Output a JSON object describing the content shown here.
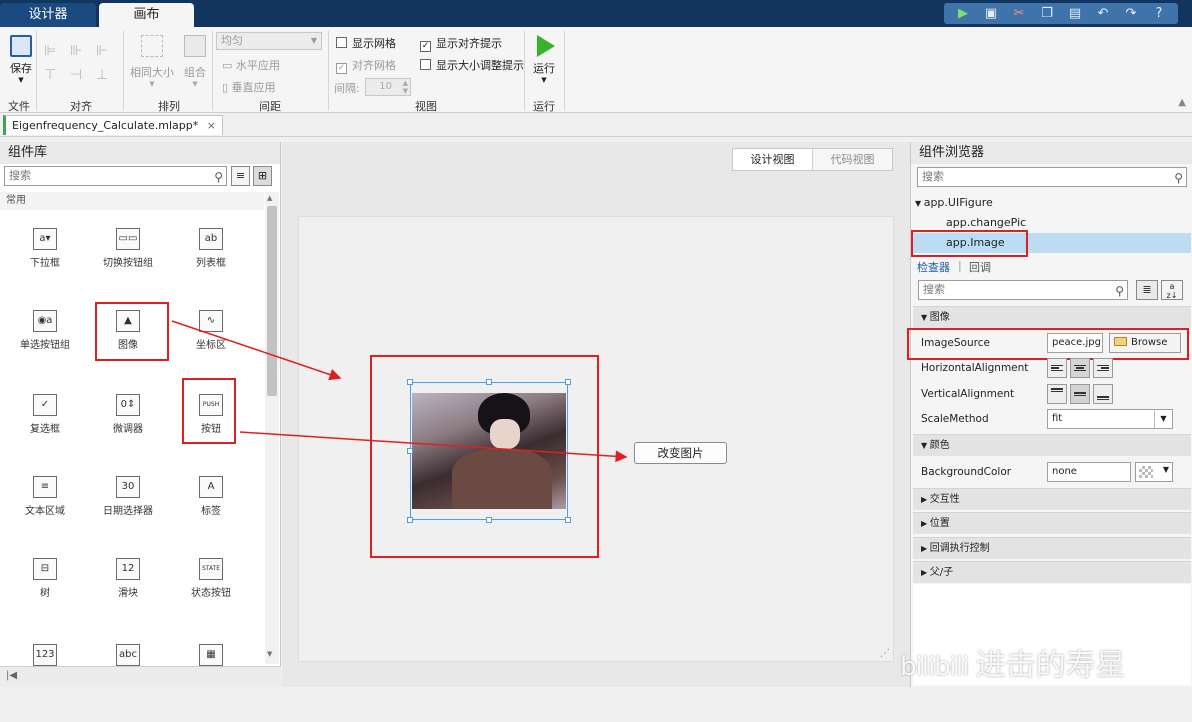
{
  "tabs": {
    "designer": "设计器",
    "canvas": "画布"
  },
  "quick_access": [
    "run-icon",
    "save-icon",
    "cut-icon",
    "copy-icon",
    "paste-icon",
    "undo-icon",
    "redo-icon",
    "help-icon"
  ],
  "ribbon": {
    "save": "保存",
    "same_size": "相同大小",
    "group": "组合",
    "spacing_select": "均匀",
    "apply_horizontal": "水平应用",
    "apply_vertical": "垂直应用",
    "show_grid": "显示网格",
    "snap_grid": "对齐网格",
    "interval": "间隔:",
    "interval_value": "10",
    "show_align_hints": "显示对齐提示",
    "show_resize_hints": "显示大小调整提示",
    "run": "运行",
    "groups": {
      "file": "文件",
      "align": "对齐",
      "arrange": "排列",
      "spacing": "间距",
      "view": "视图",
      "run": "运行"
    }
  },
  "document_tab": "Eigenfrequency_Calculate.mlapp*",
  "library": {
    "title": "组件库",
    "search_placeholder": "搜索",
    "category": "常用",
    "components": [
      {
        "label": "下拉框",
        "glyph": "a▾"
      },
      {
        "label": "切换按钮组",
        "glyph": "▭▭"
      },
      {
        "label": "列表框",
        "glyph": "ab"
      },
      {
        "label": "单选按钮组",
        "glyph": "◉a"
      },
      {
        "label": "图像",
        "glyph": "▲"
      },
      {
        "label": "坐标区",
        "glyph": "∿"
      },
      {
        "label": "复选框",
        "glyph": "✓"
      },
      {
        "label": "微调器",
        "glyph": "0⇕"
      },
      {
        "label": "按钮",
        "glyph": "PUSH"
      },
      {
        "label": "文本区域",
        "glyph": "≡"
      },
      {
        "label": "日期选择器",
        "glyph": "30"
      },
      {
        "label": "标签",
        "glyph": "A"
      },
      {
        "label": "树",
        "glyph": "⊟"
      },
      {
        "label": "滑块",
        "glyph": "12"
      },
      {
        "label": "状态按钮",
        "glyph": "STATE"
      },
      {
        "label": "",
        "glyph": "123"
      },
      {
        "label": "",
        "glyph": "abc"
      },
      {
        "label": "",
        "glyph": "▦"
      }
    ]
  },
  "canvas": {
    "design_view": "设计视图",
    "code_view": "代码视图",
    "button_label": "改变图片"
  },
  "browser": {
    "title": "组件浏览器",
    "search_placeholder": "搜索",
    "tree": {
      "root": "app.UIFigure",
      "child1": "app.changePic",
      "child2": "app.Image"
    },
    "inspector_tab": "检查器",
    "callback_tab": "回调",
    "inspector_search_placeholder": "搜索",
    "section_image": "图像",
    "image_source_label": "ImageSource",
    "image_source_value": "peace.jpg",
    "browse_button": "Browse",
    "h_align_label": "HorizontalAlignment",
    "v_align_label": "VerticalAlignment",
    "scale_method_label": "ScaleMethod",
    "scale_method_value": "fit",
    "section_color": "颜色",
    "bg_color_label": "BackgroundColor",
    "bg_color_value": "none",
    "section_interactivity": "交互性",
    "section_position": "位置",
    "section_callback_control": "回调执行控制",
    "section_parent_child": "父/子"
  },
  "watermark": "进击的寿星",
  "colors": {
    "accent_red": "#e02020",
    "selection_blue": "#bcdcf4",
    "tab_dark": "#12355f"
  }
}
